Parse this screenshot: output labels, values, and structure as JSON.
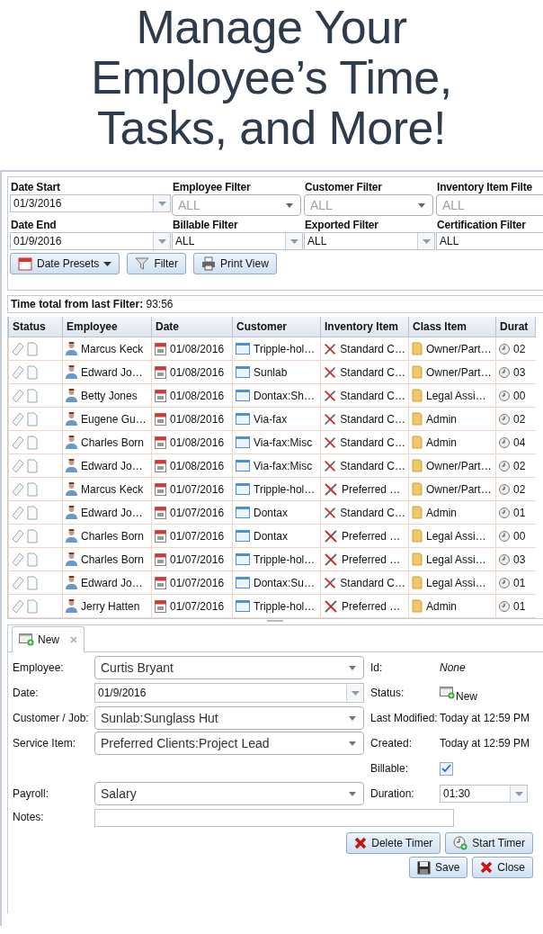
{
  "headline": "Manage Your Employee’s Time, Tasks, and More!",
  "filters": [
    {
      "label": "Date Start",
      "kind": "date",
      "value": "01/3/2016"
    },
    {
      "label": "Employee Filter",
      "kind": "combo",
      "placeholder": "ALL"
    },
    {
      "label": "Customer Filter",
      "kind": "combo",
      "placeholder": "ALL"
    },
    {
      "label": "Inventory Item Filte",
      "kind": "combo",
      "placeholder": "ALL"
    },
    {
      "label": "Date End",
      "kind": "date",
      "value": "01/9/2016"
    },
    {
      "label": "Billable Filter",
      "kind": "select",
      "value": "ALL"
    },
    {
      "label": "Exported Filter",
      "kind": "select",
      "value": "ALL"
    },
    {
      "label": "Certification Filter",
      "kind": "select",
      "value": "ALL"
    }
  ],
  "filter_buttons": [
    {
      "label": "Date Presets",
      "kind": "presets"
    },
    {
      "label": "Filter",
      "kind": "filter"
    },
    {
      "label": "Print View",
      "kind": "print"
    }
  ],
  "time_total": {
    "label": "Time total from last Filter:",
    "value": "93:56"
  },
  "table": {
    "columns": [
      "Status",
      "Employee",
      "Date",
      "Customer",
      "Inventory Item",
      "Class Item",
      "Durat"
    ],
    "rows": [
      {
        "employee": "Marcus Keck",
        "date": "01/08/2016",
        "customer": "Tripple-hol…",
        "inventory_item": "Standard C…",
        "class_item": "Owner/Part…",
        "duration": "02"
      },
      {
        "employee": "Edward Jo…",
        "date": "01/08/2016",
        "customer": "Sunlab",
        "inventory_item": "Standard C…",
        "class_item": "Owner/Part…",
        "duration": "03"
      },
      {
        "employee": "Betty Jones",
        "date": "01/08/2016",
        "customer": "Dontax:Sh…",
        "inventory_item": "Standard C…",
        "class_item": "Legal Assi…",
        "duration": "00"
      },
      {
        "employee": "Eugene Gu…",
        "date": "01/08/2016",
        "customer": "Via-fax",
        "inventory_item": "Standard C…",
        "class_item": "Admin",
        "duration": "02"
      },
      {
        "employee": "Charles Born",
        "date": "01/08/2016",
        "customer": "Via-fax:Misc",
        "inventory_item": "Standard C…",
        "class_item": "Admin",
        "duration": "04"
      },
      {
        "employee": "Edward Jo…",
        "date": "01/08/2016",
        "customer": "Via-fax:Misc",
        "inventory_item": "Standard C…",
        "class_item": "Owner/Part…",
        "duration": "02"
      },
      {
        "employee": "Marcus Keck",
        "date": "01/07/2016",
        "customer": "Tripple-hol…",
        "inventory_item": "Preferred …",
        "class_item": "Owner/Part…",
        "duration": "02"
      },
      {
        "employee": "Edward Jo…",
        "date": "01/07/2016",
        "customer": "Dontax",
        "inventory_item": "Standard C…",
        "class_item": "Admin",
        "duration": "01"
      },
      {
        "employee": "Charles Born",
        "date": "01/07/2016",
        "customer": "Dontax",
        "inventory_item": "Preferred …",
        "class_item": "Legal Assi…",
        "duration": "00"
      },
      {
        "employee": "Charles Born",
        "date": "01/07/2016",
        "customer": "Tripple-hol…",
        "inventory_item": "Preferred …",
        "class_item": "Legal Assi…",
        "duration": "03"
      },
      {
        "employee": "Edward Jo…",
        "date": "01/07/2016",
        "customer": "Dontax:Su…",
        "inventory_item": "Standard C…",
        "class_item": "Legal Assi…",
        "duration": "01"
      },
      {
        "employee": "Jerry Hatten",
        "date": "01/07/2016",
        "customer": "Tripple-hol…",
        "inventory_item": "Preferred …",
        "class_item": "Admin",
        "duration": "01"
      }
    ]
  },
  "detail": {
    "tab": {
      "label": "New",
      "selected": true
    },
    "left_fields": [
      {
        "label": "Employee:",
        "kind": "combo",
        "value": "Curtis Bryant"
      },
      {
        "label": "Date:",
        "kind": "date",
        "value": "01/9/2016"
      },
      {
        "label": "Customer / Job:",
        "kind": "combo",
        "value": "Sunlab:Sunglass Hut"
      },
      {
        "label": "Service Item:",
        "kind": "combo",
        "value": "Preferred Clients:Project Lead"
      },
      {
        "kind": "blank"
      },
      {
        "label": "Payroll:",
        "kind": "combo",
        "value": "Salary"
      }
    ],
    "right_fields": [
      {
        "label": "Id:",
        "kind": "italic",
        "value": "None"
      },
      {
        "label": "Status:",
        "kind": "status",
        "value": "New"
      },
      {
        "label": "Last Modified:",
        "kind": "text",
        "value": "Today at 12:59 PM"
      },
      {
        "label": "Created:",
        "kind": "text",
        "value": "Today at 12:59 PM"
      },
      {
        "label": "Billable:",
        "kind": "checkbox",
        "checked": true
      },
      {
        "label": "Duration:",
        "kind": "spinner",
        "value": "01:30"
      }
    ],
    "notes": {
      "label": "Notes:"
    },
    "buttons": [
      [
        {
          "label": "Delete Timer",
          "kind": "delete"
        },
        {
          "label": "Start Timer",
          "kind": "start"
        }
      ],
      [
        {
          "label": "Save",
          "kind": "save"
        },
        {
          "label": "Close",
          "kind": "close"
        }
      ]
    ]
  }
}
